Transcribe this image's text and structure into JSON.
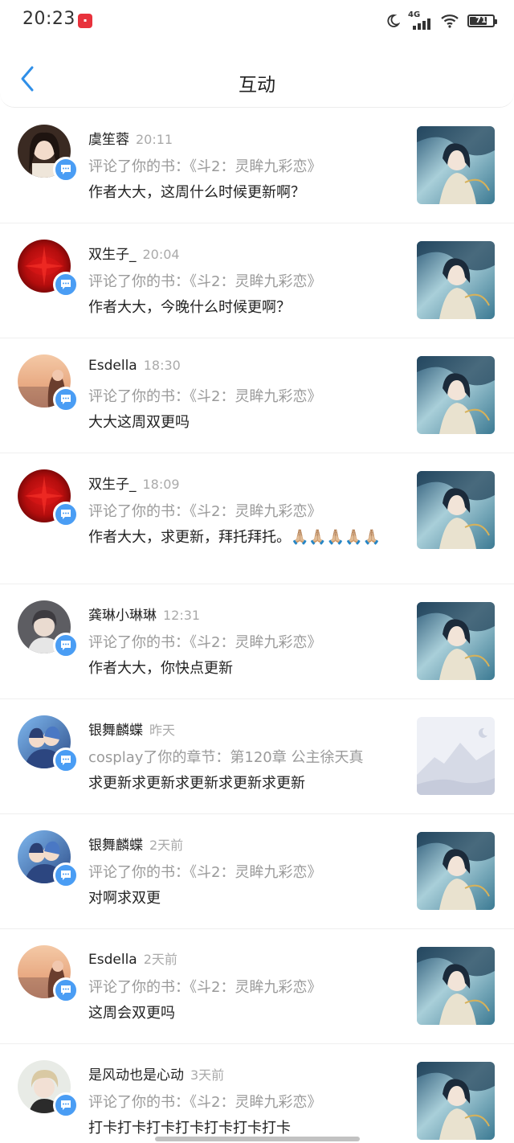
{
  "status_bar": {
    "time": "20:23",
    "app_icon": "red-app-icon",
    "network": "4G",
    "battery": "71"
  },
  "nav": {
    "title": "互动",
    "back_icon": "chevron-left-icon"
  },
  "items": [
    {
      "name": "虞笙蓉",
      "time": "20:11",
      "action": "评论了你的书：《斗2：灵眸九彩恋》",
      "comment": "作者大大，这周什么时候更新啊？",
      "avatar": "avatar-girl-dark",
      "cover": "book-cover-anime"
    },
    {
      "name": "双生子_",
      "time": "20:04",
      "action": "评论了你的书：《斗2：灵眸九彩恋》",
      "comment": "作者大大，今晚什么时候更啊？",
      "avatar": "avatar-red-flower",
      "cover": "book-cover-anime"
    },
    {
      "name": "Esdella",
      "time": "18:30",
      "action": "评论了你的书：《斗2：灵眸九彩恋》",
      "comment": "大大这周双更吗",
      "avatar": "avatar-sunset-girl",
      "cover": "book-cover-anime"
    },
    {
      "name": "双生子_",
      "time": "18:09",
      "action": "评论了你的书：《斗2：灵眸九彩恋》",
      "comment": "作者大大，求更新，拜托拜托。🙏🏼🙏🏼🙏🏼🙏🏼🙏🏼",
      "avatar": "avatar-red-flower",
      "cover": "book-cover-anime"
    },
    {
      "name": "龚琳小琳琳",
      "time": "12:31",
      "action": "评论了你的书：《斗2：灵眸九彩恋》",
      "comment": "作者大大，你快点更新",
      "avatar": "avatar-boy-gray",
      "cover": "book-cover-anime"
    },
    {
      "name": "银舞麟蝶",
      "time": "昨天",
      "action": "cosplay了你的章节：第120章 公主徐天真",
      "comment": "求更新求更新求更新求更新求更新",
      "avatar": "avatar-anime-couple",
      "cover": "placeholder-mountain-cover"
    },
    {
      "name": "银舞麟蝶",
      "time": "2天前",
      "action": "评论了你的书：《斗2：灵眸九彩恋》",
      "comment": "对啊求双更",
      "avatar": "avatar-anime-couple",
      "cover": "book-cover-anime"
    },
    {
      "name": "Esdella",
      "time": "2天前",
      "action": "评论了你的书：《斗2：灵眸九彩恋》",
      "comment": "这周会双更吗",
      "avatar": "avatar-sunset-girl",
      "cover": "book-cover-anime"
    },
    {
      "name": "是风动也是心动",
      "time": "3天前",
      "action": "评论了你的书：《斗2：灵眸九彩恋》",
      "comment": "打卡打卡打卡打卡打卡打卡打卡",
      "avatar": "avatar-blond-boy",
      "cover": "book-cover-anime"
    }
  ],
  "colors": {
    "accent": "#4a9df4",
    "muted_text": "#9a9a9a",
    "divider": "#efefef"
  }
}
